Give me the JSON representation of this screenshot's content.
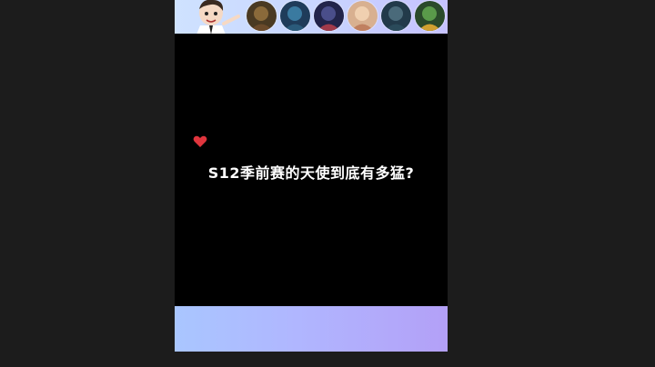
{
  "video": {
    "subtitle": "S12季前赛的天使到底有多猛?"
  },
  "top_banner": {
    "avatars": [
      {
        "icon": "hero-avatar-1-icon",
        "color": "#5a4a2a"
      },
      {
        "icon": "hero-avatar-2-icon",
        "color": "#2a4a6a"
      },
      {
        "icon": "hero-avatar-3-icon",
        "color": "#2c2f5a"
      },
      {
        "icon": "hero-avatar-4-icon",
        "color": "#c8a080"
      },
      {
        "icon": "hero-avatar-5-icon",
        "color": "#2e4a5a"
      },
      {
        "icon": "hero-avatar-6-icon",
        "color": "#3a6a3a"
      }
    ]
  },
  "colors": {
    "background": "#1c1c1c",
    "video_bg": "#000000",
    "heart": "#e0353d",
    "subtitle": "#ffffff"
  }
}
